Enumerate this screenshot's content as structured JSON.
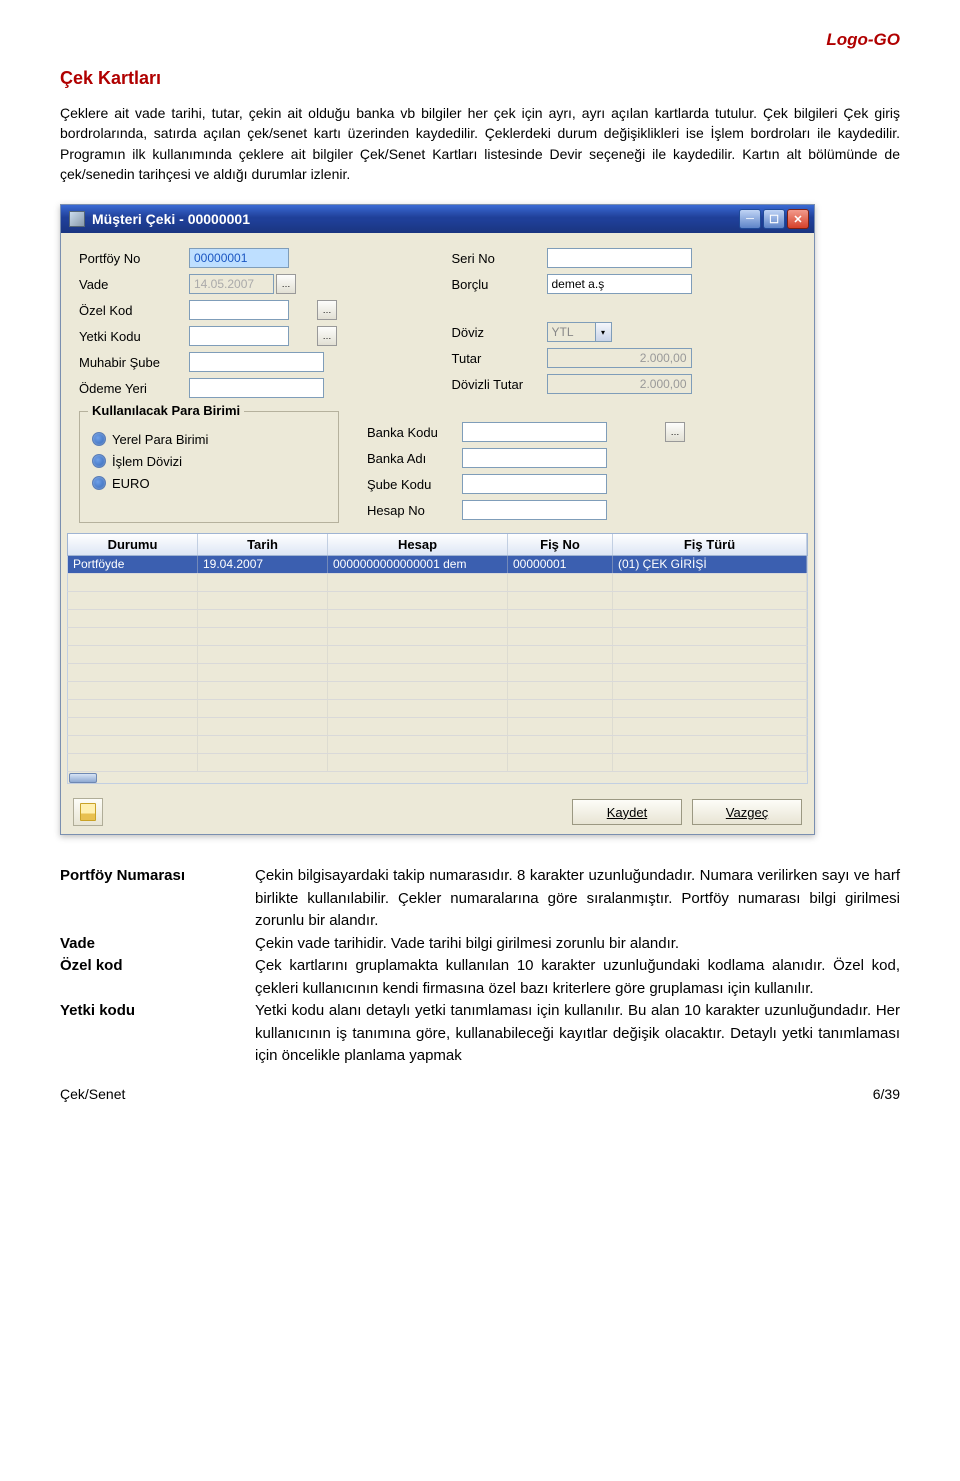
{
  "brand": "Logo-GO",
  "section_title": "Çek Kartları",
  "paragraph": "Çeklere ait vade tarihi, tutar, çekin ait olduğu banka vb bilgiler her çek için ayrı, ayrı açılan kartlarda tutulur. Çek bilgileri Çek giriş bordrolarında, satırda açılan çek/senet kartı üzerinden kaydedilir. Çeklerdeki durum değişiklikleri ise İşlem bordroları ile kaydedilir. Programın ilk kullanımında çeklere ait bilgiler Çek/Senet Kartları listesinde Devir seçeneği ile kaydedilir. Kartın alt bölümünde de çek/senedin tarihçesi ve aldığı durumlar izlenir.",
  "window": {
    "title": "Müşteri Çeki - 00000001",
    "left": {
      "portfoy_no": {
        "label": "Portföy No",
        "value": "00000001"
      },
      "vade": {
        "label": "Vade",
        "value": "14.05.2007"
      },
      "ozel_kod": {
        "label": "Özel Kod",
        "value": ""
      },
      "yetki_kodu": {
        "label": "Yetki Kodu",
        "value": ""
      },
      "muhabir_sube": {
        "label": "Muhabir Şube",
        "value": ""
      },
      "odeme_yeri": {
        "label": "Ödeme Yeri",
        "value": ""
      }
    },
    "right": {
      "seri_no": {
        "label": "Seri No",
        "value": ""
      },
      "borclu": {
        "label": "Borçlu",
        "value": "demet a.ş"
      },
      "doviz": {
        "label": "Döviz",
        "value": "YTL"
      },
      "tutar": {
        "label": "Tutar",
        "value": "2.000,00"
      },
      "dovizli_tutar": {
        "label": "Dövizli Tutar",
        "value": "2.000,00"
      }
    },
    "currency_group": {
      "title": "Kullanılacak Para Birimi",
      "opts": {
        "yerel": "Yerel Para Birimi",
        "islem": "İşlem Dövizi",
        "euro": "EURO"
      }
    },
    "bank": {
      "banka_kodu": {
        "label": "Banka Kodu",
        "value": ""
      },
      "banka_adi": {
        "label": "Banka Adı",
        "value": ""
      },
      "sube_kodu": {
        "label": "Şube Kodu",
        "value": ""
      },
      "hesap_no": {
        "label": "Hesap No",
        "value": ""
      }
    },
    "grid": {
      "headers": {
        "durumu": "Durumu",
        "tarih": "Tarih",
        "hesap": "Hesap",
        "fis_no": "Fiş No",
        "fis_turu": "Fiş Türü"
      },
      "row": {
        "durumu": "Portföyde",
        "tarih": "19.04.2007",
        "hesap": "0000000000000001 dem",
        "fis_no": "00000001",
        "fis_turu": "(01) ÇEK GİRİŞİ"
      }
    },
    "buttons": {
      "kaydet": "Kaydet",
      "vazgec": "Vazgeç"
    }
  },
  "defs": {
    "portfoy": {
      "term": "Portföy Numarası",
      "desc": "Çekin bilgisayardaki takip numarasıdır. 8 karakter uzunluğundadır. Numara verilirken sayı ve harf birlikte kullanılabilir. Çekler numaralarına göre sıralanmıştır. Portföy numarası bilgi girilmesi zorunlu bir alandır."
    },
    "vade": {
      "term": "Vade",
      "desc": "Çekin vade tarihidir. Vade tarihi bilgi girilmesi zorunlu bir alandır."
    },
    "ozel": {
      "term": "Özel kod",
      "desc": "Çek kartlarını gruplamakta kullanılan 10 karakter uzunluğundaki kodlama alanıdır. Özel kod, çekleri kullanıcının kendi firmasına özel bazı kriterlere göre gruplaması için kullanılır."
    },
    "yetki": {
      "term": "Yetki kodu",
      "desc": "Yetki kodu alanı detaylı yetki tanımlaması için kullanılır. Bu alan 10 karakter uzunluğundadır. Her kullanıcının iş tanımına göre, kullanabileceği kayıtlar değişik olacaktır. Detaylı yetki tanımlaması için öncelikle planlama yapmak"
    }
  },
  "footer": {
    "left": "Çek/Senet",
    "right": "6/39"
  }
}
